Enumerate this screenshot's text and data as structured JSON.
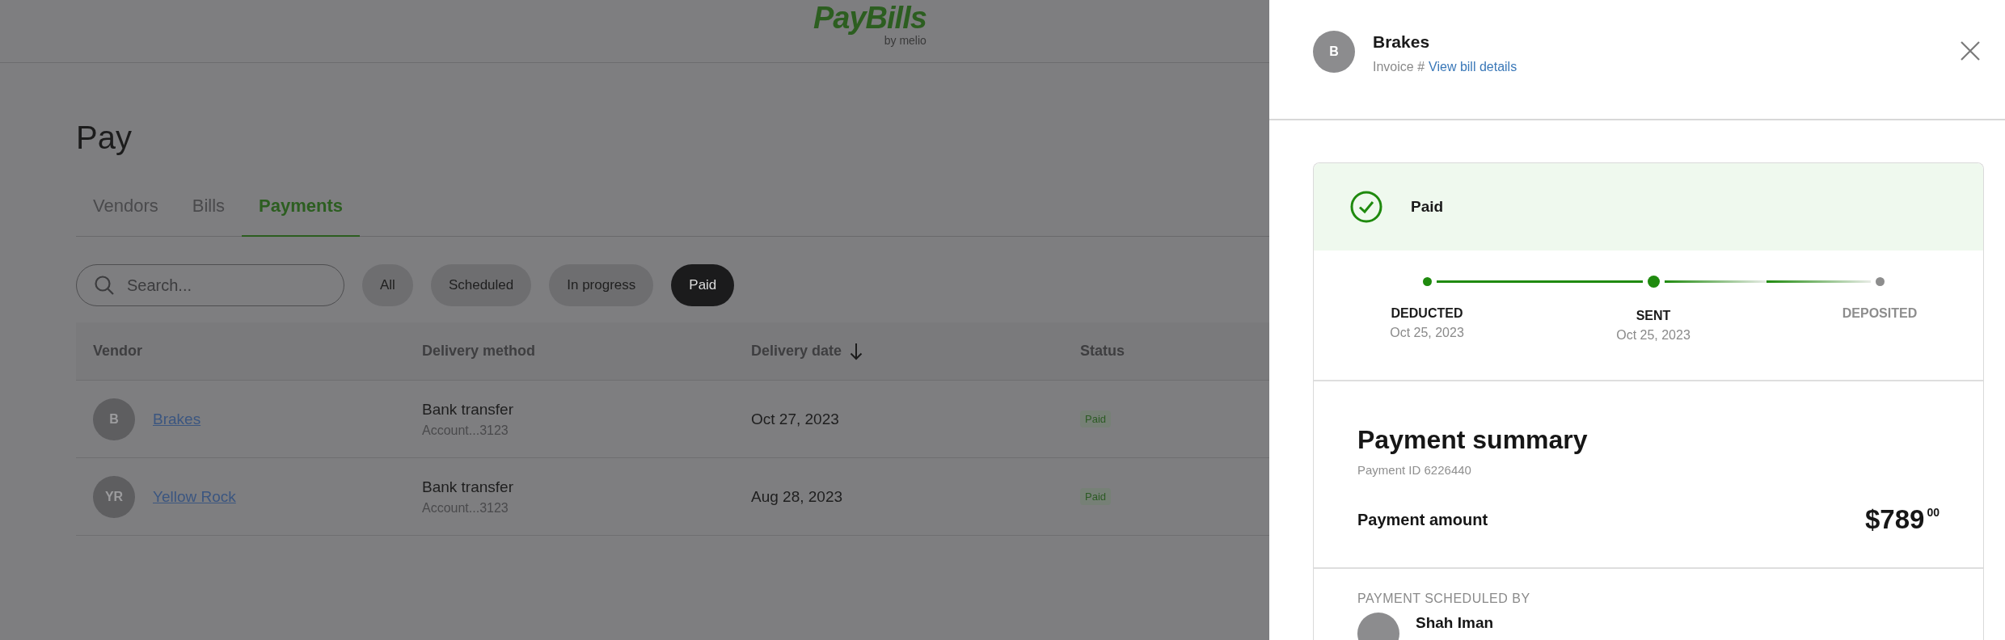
{
  "header": {
    "logo": "PayBills",
    "logo_sub": "by melio"
  },
  "page": {
    "title": "Pay"
  },
  "tabs": [
    {
      "label": "Vendors",
      "selected": false
    },
    {
      "label": "Bills",
      "selected": false
    },
    {
      "label": "Payments",
      "selected": true
    }
  ],
  "search": {
    "placeholder": "Search..."
  },
  "filters": [
    {
      "label": "All",
      "selected": false
    },
    {
      "label": "Scheduled",
      "selected": false
    },
    {
      "label": "In progress",
      "selected": false
    },
    {
      "label": "Paid",
      "selected": true
    }
  ],
  "table": {
    "columns": [
      {
        "label": "Vendor",
        "sorted": false
      },
      {
        "label": "Delivery method",
        "sorted": false
      },
      {
        "label": "Delivery date",
        "sorted": true
      },
      {
        "label": "Status",
        "sorted": false
      }
    ],
    "rows": [
      {
        "avatar": "B",
        "vendor": "Brakes",
        "method": "Bank transfer",
        "account": "Account...3123",
        "date": "Oct 27, 2023",
        "status": "Paid"
      },
      {
        "avatar": "YR",
        "vendor": "Yellow Rock",
        "method": "Bank transfer",
        "account": "Account...3123",
        "date": "Aug 28, 2023",
        "status": "Paid"
      }
    ]
  },
  "panel": {
    "avatar": "B",
    "title": "Brakes",
    "invoice_label": "Invoice #",
    "invoice_link": "View bill details",
    "status": "Paid",
    "timeline": [
      {
        "label": "DEDUCTED",
        "date": "Oct 25, 2023",
        "done": true,
        "current": false
      },
      {
        "label": "SENT",
        "date": "Oct 25, 2023",
        "done": true,
        "current": true
      },
      {
        "label": "DEPOSITED",
        "done": false,
        "current": false
      }
    ],
    "summary": {
      "title": "Payment summary",
      "payment_id": "Payment ID 6226440",
      "amount_label": "Payment amount",
      "amount": "$789",
      "amount_cents": "00"
    },
    "scheduled_by": {
      "label": "PAYMENT SCHEDULED BY",
      "name": "Shah Iman"
    }
  }
}
